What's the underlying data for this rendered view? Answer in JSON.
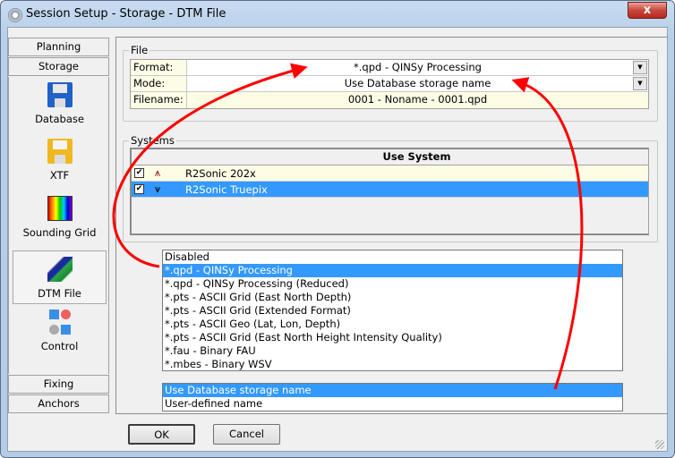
{
  "window": {
    "title": "Session Setup - Storage -  DTM File",
    "close_label": "x"
  },
  "sidebar": {
    "top_buttons": [
      "Planning",
      "Storage"
    ],
    "items": [
      {
        "label": "Database",
        "icon": "floppy-blue-icon"
      },
      {
        "label": "XTF",
        "icon": "floppy-yellow-icon"
      },
      {
        "label": "Sounding Grid",
        "icon": "grid-color-icon"
      },
      {
        "label": "DTM File",
        "icon": "dtm-icon",
        "selected": true
      },
      {
        "label": "Control",
        "icon": "control-icon"
      }
    ],
    "bottom_buttons": [
      "Fixing",
      "Anchors"
    ]
  },
  "file_group": {
    "title": "File",
    "rows": [
      {
        "label": "Format:",
        "value": "*.qpd - QINSy Processing"
      },
      {
        "label": "Mode:",
        "value": "Use Database storage name"
      },
      {
        "label": "Filename:",
        "value": "0001 - Noname - 0001.qpd"
      }
    ]
  },
  "systems_group": {
    "title": "Systems",
    "header": "Use System",
    "rows": [
      {
        "name": "R2Sonic 202x",
        "checked": true
      },
      {
        "name": "R2Sonic Truepix",
        "checked": true,
        "selected": true
      }
    ]
  },
  "format_list": {
    "items": [
      "Disabled",
      "*.qpd - QINSy Processing",
      "*.qpd - QINSy Processing (Reduced)",
      "*.pts - ASCII Grid (East North Depth)",
      "*.pts - ASCII Grid (Extended Format)",
      "*.pts - ASCII Geo  (Lat, Lon,  Depth)",
      "*.pts - ASCII Grid (East North Height Intensity Quality)",
      "*.fau - Binary FAU",
      "*.mbes - Binary WSV"
    ],
    "selected_index": 1
  },
  "mode_list": {
    "items": [
      "Use Database storage name",
      "User-defined name"
    ],
    "selected_index": 0
  },
  "buttons": {
    "ok": "OK",
    "cancel": "Cancel"
  },
  "colors": {
    "selection": "#3399ff",
    "annotation": "#ff0000",
    "cell_yellow": "#fdfde6"
  }
}
